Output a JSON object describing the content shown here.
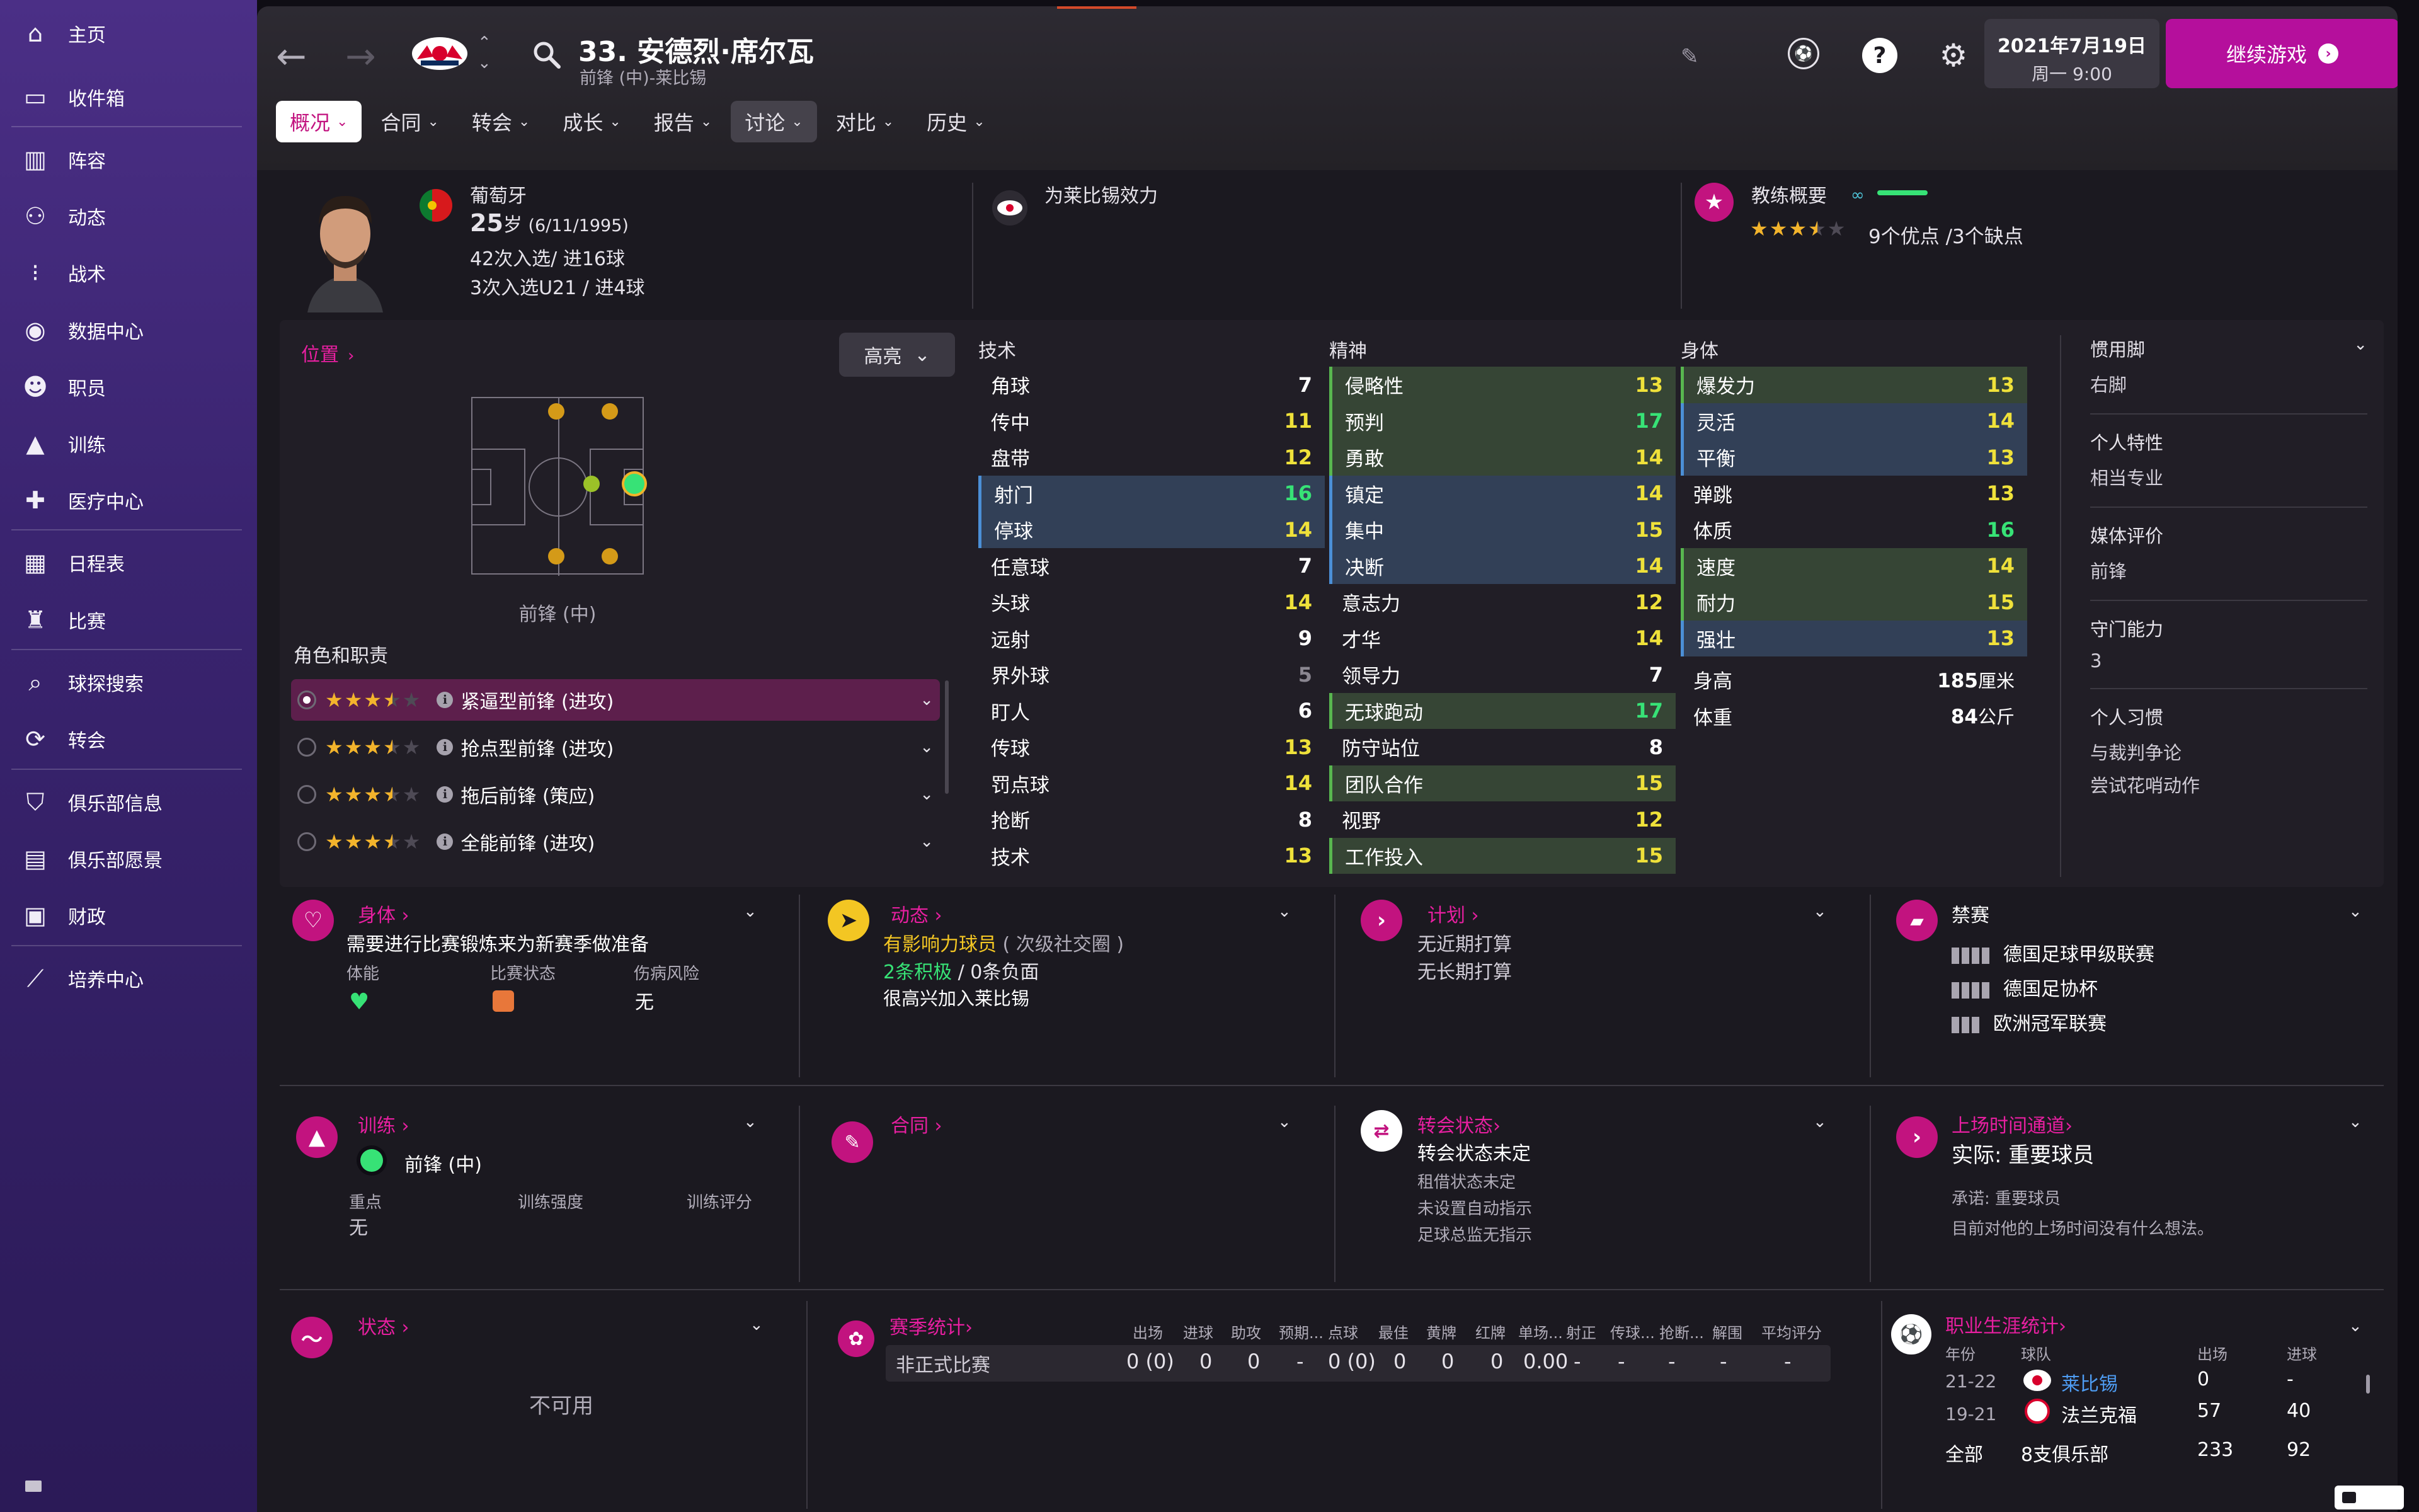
{
  "sidebar": {
    "items": [
      {
        "label": "主页",
        "icon": "home-icon"
      },
      {
        "label": "收件箱",
        "icon": "inbox-icon"
      },
      {
        "label": "阵容",
        "icon": "squad-icon"
      },
      {
        "label": "动态",
        "icon": "dynamics-icon"
      },
      {
        "label": "战术",
        "icon": "tactics-icon"
      },
      {
        "label": "数据中心",
        "icon": "data-hub-icon"
      },
      {
        "label": "职员",
        "icon": "staff-icon"
      },
      {
        "label": "训练",
        "icon": "training-icon"
      },
      {
        "label": "医疗中心",
        "icon": "medical-icon"
      },
      {
        "label": "日程表",
        "icon": "calendar-icon"
      },
      {
        "label": "比赛",
        "icon": "trophy-icon"
      },
      {
        "label": "球探搜索",
        "icon": "scouting-icon"
      },
      {
        "label": "转会",
        "icon": "transfers-icon"
      },
      {
        "label": "俱乐部信息",
        "icon": "club-info-icon"
      },
      {
        "label": "俱乐部愿景",
        "icon": "club-vision-icon"
      },
      {
        "label": "财政",
        "icon": "finances-icon"
      },
      {
        "label": "培养中心",
        "icon": "development-icon"
      }
    ]
  },
  "header": {
    "player_title": "33. 安德烈·席尔瓦",
    "player_subtitle": "前锋 (中)-莱比锡",
    "date_line1": "2021年7月19日",
    "date_line2": "周一 9:00",
    "continue_label": "继续游戏",
    "help_glyph": "?"
  },
  "tabs": [
    {
      "label": "概况"
    },
    {
      "label": "合同"
    },
    {
      "label": "转会"
    },
    {
      "label": "成长"
    },
    {
      "label": "报告"
    },
    {
      "label": "讨论"
    },
    {
      "label": "对比"
    },
    {
      "label": "历史"
    }
  ],
  "profile": {
    "nation": "葡萄牙",
    "age": "25",
    "age_unit": "岁",
    "dob": "(6/11/1995)",
    "caps": "42次入选/ 进16球",
    "u21_caps": "3次入选U21 / 进4球",
    "plays_for": "为莱比锡效力",
    "coach_summary_label": "教练概要",
    "coach_stars": 3.5,
    "pros_cons": "9个优点 /3个缺点"
  },
  "position_panel": {
    "title": "位置",
    "highlight_label": "高亮",
    "position_label": "前锋 (中)",
    "roles_title": "角色和职责",
    "roles": [
      {
        "label": "紧逼型前锋 (进攻)",
        "stars": 3.5,
        "selected": true
      },
      {
        "label": "抢点型前锋 (进攻)",
        "stars": 3.5,
        "selected": false
      },
      {
        "label": "拖后前锋 (策应)",
        "stars": 3.5,
        "selected": false
      },
      {
        "label": "全能前锋 (进攻)",
        "stars": 3.5,
        "selected": false
      }
    ]
  },
  "attributes": {
    "technical_title": "技术",
    "mental_title": "精神",
    "physical_title": "身体",
    "technical": [
      {
        "name": "角球",
        "value": "7",
        "tone": "w",
        "hl": ""
      },
      {
        "name": "传中",
        "value": "11",
        "tone": "y",
        "hl": ""
      },
      {
        "name": "盘带",
        "value": "12",
        "tone": "y",
        "hl": ""
      },
      {
        "name": "射门",
        "value": "16",
        "tone": "g",
        "hl": "blue"
      },
      {
        "name": "停球",
        "value": "14",
        "tone": "y",
        "hl": "blue"
      },
      {
        "name": "任意球",
        "value": "7",
        "tone": "w",
        "hl": ""
      },
      {
        "name": "头球",
        "value": "14",
        "tone": "y",
        "hl": ""
      },
      {
        "name": "远射",
        "value": "9",
        "tone": "w",
        "hl": ""
      },
      {
        "name": "界外球",
        "value": "5",
        "tone": "gr",
        "hl": ""
      },
      {
        "name": "盯人",
        "value": "6",
        "tone": "w",
        "hl": ""
      },
      {
        "name": "传球",
        "value": "13",
        "tone": "y",
        "hl": ""
      },
      {
        "name": "罚点球",
        "value": "14",
        "tone": "y",
        "hl": ""
      },
      {
        "name": "抢断",
        "value": "8",
        "tone": "w",
        "hl": ""
      },
      {
        "name": "技术",
        "value": "13",
        "tone": "y",
        "hl": ""
      }
    ],
    "mental": [
      {
        "name": "侵略性",
        "value": "13",
        "tone": "y",
        "hl": "green"
      },
      {
        "name": "预判",
        "value": "17",
        "tone": "g",
        "hl": "green"
      },
      {
        "name": "勇敢",
        "value": "14",
        "tone": "y",
        "hl": "green"
      },
      {
        "name": "镇定",
        "value": "14",
        "tone": "y",
        "hl": "blue"
      },
      {
        "name": "集中",
        "value": "15",
        "tone": "y",
        "hl": "blue"
      },
      {
        "name": "决断",
        "value": "14",
        "tone": "y",
        "hl": "blue"
      },
      {
        "name": "意志力",
        "value": "12",
        "tone": "y",
        "hl": ""
      },
      {
        "name": "才华",
        "value": "14",
        "tone": "y",
        "hl": ""
      },
      {
        "name": "领导力",
        "value": "7",
        "tone": "w",
        "hl": ""
      },
      {
        "name": "无球跑动",
        "value": "17",
        "tone": "g",
        "hl": "green"
      },
      {
        "name": "防守站位",
        "value": "8",
        "tone": "w",
        "hl": ""
      },
      {
        "name": "团队合作",
        "value": "15",
        "tone": "y",
        "hl": "green"
      },
      {
        "name": "视野",
        "value": "12",
        "tone": "y",
        "hl": ""
      },
      {
        "name": "工作投入",
        "value": "15",
        "tone": "y",
        "hl": "green"
      }
    ],
    "physical": [
      {
        "name": "爆发力",
        "value": "13",
        "tone": "y",
        "hl": "green"
      },
      {
        "name": "灵活",
        "value": "14",
        "tone": "y",
        "hl": "blue"
      },
      {
        "name": "平衡",
        "value": "13",
        "tone": "y",
        "hl": "blue"
      },
      {
        "name": "弹跳",
        "value": "13",
        "tone": "y",
        "hl": ""
      },
      {
        "name": "体质",
        "value": "16",
        "tone": "g",
        "hl": ""
      },
      {
        "name": "速度",
        "value": "14",
        "tone": "y",
        "hl": "green"
      },
      {
        "name": "耐力",
        "value": "15",
        "tone": "y",
        "hl": "green"
      },
      {
        "name": "强壮",
        "value": "13",
        "tone": "y",
        "hl": "blue"
      }
    ],
    "height_label": "身高",
    "height_value": "185",
    "height_unit": "厘米",
    "weight_label": "体重",
    "weight_value": "84",
    "weight_unit": "公斤"
  },
  "right_info": {
    "foot_label": "惯用脚",
    "foot_value": "右脚",
    "personality_label": "个人特性",
    "personality_value": "相当专业",
    "media_label": "媒体评价",
    "media_value": "前锋",
    "gk_label": "守门能力",
    "gk_value": "3",
    "habits_label": "个人习惯",
    "habit1": "与裁判争论",
    "habit2": "尝试花哨动作"
  },
  "cards": {
    "physical": {
      "title": "身体",
      "text": "需要进行比赛锻炼来为新赛季做准备",
      "c1": "体能",
      "c2": "比赛状态",
      "c3": "伤病风险",
      "c3_value": "无"
    },
    "dynamics": {
      "title": "动态",
      "influence": "有影响力球员",
      "group": "( 次级社交圈 )",
      "positive": "2条积极",
      "slash": "/",
      "negative": "0条负面",
      "happy": "很高兴加入莱比锡"
    },
    "plans": {
      "title": "计划",
      "l1": "无近期打算",
      "l2": "无长期打算"
    },
    "bans": {
      "title": "禁赛",
      "l1": "德国足球甲级联赛",
      "l2": "德国足协杯",
      "l3": "欧洲冠军联赛"
    },
    "training": {
      "title": "训练",
      "position": "前锋 (中)",
      "focus": "重点",
      "focus_value": "无",
      "intensity": "训练强度",
      "rating": "训练评分"
    },
    "contract": {
      "title": "合同"
    },
    "transfer": {
      "title": "转会状态",
      "status": "转会状态未定",
      "l1": "租借状态未定",
      "l2": "未设置自动指示",
      "l3": "足球总监无指示"
    },
    "playtime": {
      "title": "上场时间通道",
      "actual": "实际: 重要球员",
      "promised": "承诺: 重要球员",
      "note": "目前对他的上场时间没有什么想法。"
    },
    "form": {
      "title": "状态",
      "unavailable": "不可用"
    }
  },
  "season_stats": {
    "title": "赛季统计",
    "headers": [
      "出场",
      "进球",
      "助攻",
      "预期...",
      "点球",
      "最佳",
      "黄牌",
      "红牌",
      "单场...",
      "射正",
      "传球...",
      "抢断...",
      "解围",
      "平均评分"
    ],
    "row_label": "非正式比赛",
    "row_values": [
      "0 (0)",
      "0",
      "0",
      "-",
      "0 (0)",
      "0",
      "0",
      "0",
      "0.00",
      "-",
      "-",
      "-",
      "-",
      "-"
    ]
  },
  "career": {
    "title": "职业生涯统计",
    "h_year": "年份",
    "h_club": "球队",
    "h_apps": "出场",
    "h_goals": "进球",
    "rows": [
      {
        "year": "21-22",
        "club": "莱比锡",
        "apps": "0",
        "goals": "-"
      },
      {
        "year": "19-21",
        "club": "法兰克福",
        "apps": "57",
        "goals": "40"
      }
    ],
    "total_label": "全部",
    "total_clubs": "8支俱乐部",
    "total_apps": "233",
    "total_goals": "92"
  },
  "colors": {
    "accent": "#e71fa0",
    "continue": "#b50f9c",
    "sidebar": "#3a2470"
  }
}
